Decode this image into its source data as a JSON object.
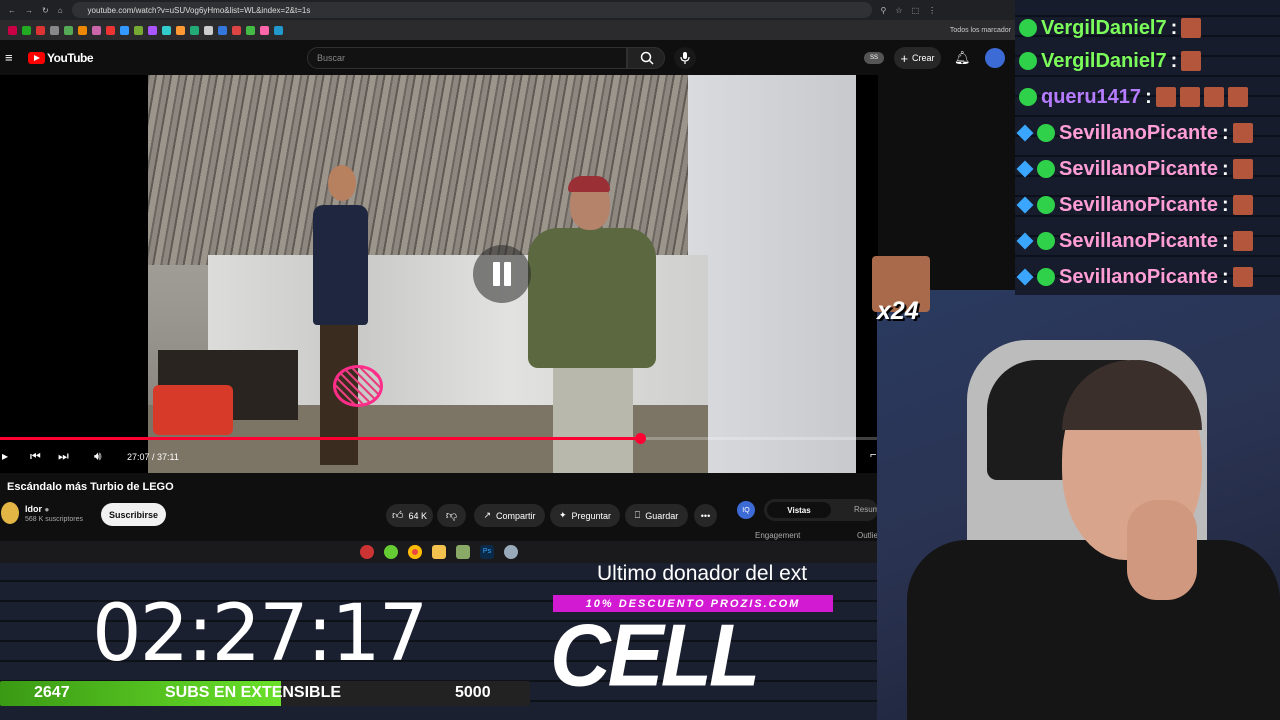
{
  "browser": {
    "url": "youtube.com/watch?v=uSUVog6yHmo&list=WL&index=2&t=1s",
    "bookmarks_all": "Todos los marcador"
  },
  "youtube": {
    "logo": "YouTube",
    "search_placeholder": "Buscar",
    "create_label": "Crear",
    "video": {
      "time": "27:07 / 37:11",
      "progress_fraction": 0.729,
      "title": "Escándalo más Turbio de LEGO",
      "channel": "ldor",
      "subscribers": "568 K suscriptores",
      "subscribe_label": "Suscribirse",
      "likes": "64 K",
      "share_label": "Compartir",
      "ask_label": "Preguntar",
      "save_label": "Guardar"
    },
    "side_tabs": [
      "Vistas",
      "Resum"
    ],
    "side_sub": [
      "Engagement",
      "Outlie"
    ]
  },
  "overlay": {
    "timer": "02:27:17",
    "subs_current": "2647",
    "subs_label": "SUBS EN EXTENSIBLE",
    "subs_goal": "5000",
    "subs_fraction": 0.53,
    "donor_title": "Ultimo donador del ext",
    "promo": "10% DESCUENTO PROZIS.COM",
    "donor_name": "CELL",
    "combo": "x24"
  },
  "chat": {
    "messages": [
      {
        "user": "VergilDaniel7",
        "color": "#7CFC5A",
        "badges": [
          "green"
        ],
        "emotes": 1
      },
      {
        "user": "VergilDaniel7",
        "color": "#7CFC5A",
        "badges": [
          "green"
        ],
        "emotes": 1
      },
      {
        "user": "queru1417",
        "color": "#B67CFF",
        "badges": [
          "green"
        ],
        "emotes": 4
      },
      {
        "user": "SevillanoPicante",
        "color": "#FF9DD6",
        "badges": [
          "cube",
          "green"
        ],
        "emotes": 1
      },
      {
        "user": "SevillanoPicante",
        "color": "#FF9DD6",
        "badges": [
          "cube",
          "green"
        ],
        "emotes": 1
      },
      {
        "user": "SevillanoPicante",
        "color": "#FF9DD6",
        "badges": [
          "cube",
          "green"
        ],
        "emotes": 1
      },
      {
        "user": "SevillanoPicante",
        "color": "#FF9DD6",
        "badges": [
          "cube",
          "green"
        ],
        "emotes": 1
      },
      {
        "user": "SevillanoPicante",
        "color": "#FF9DD6",
        "badges": [
          "cube",
          "green"
        ],
        "emotes": 1
      }
    ]
  },
  "colors": {
    "accent": "#ff0033",
    "subs_green": "#6ae02a",
    "promo": "#d11ad1"
  }
}
